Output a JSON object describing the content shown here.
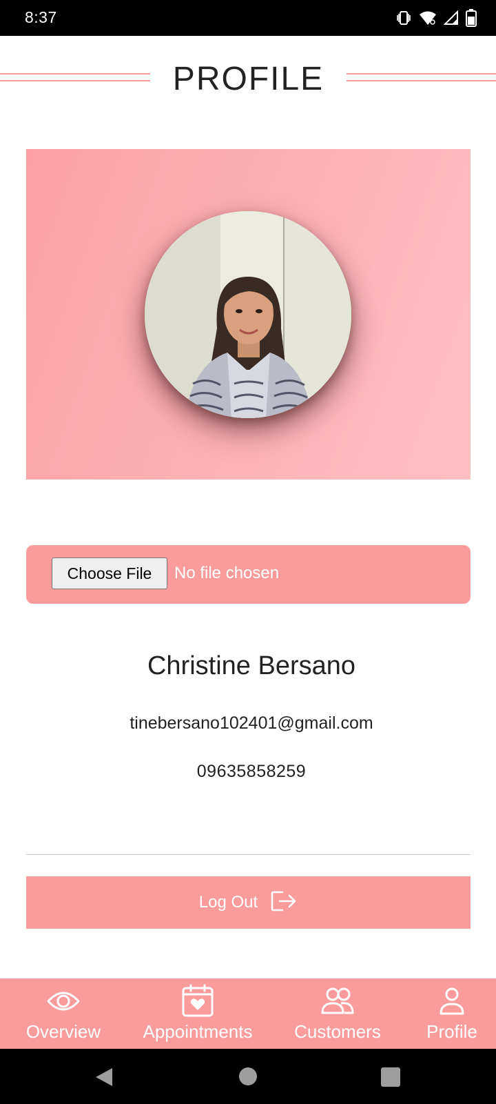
{
  "status_bar": {
    "time": "8:37",
    "icons": [
      "vibrate-icon",
      "wifi-icon",
      "signal-icon",
      "battery-icon"
    ]
  },
  "header": {
    "title": "PROFILE"
  },
  "profile": {
    "avatar_icon": "profile-photo",
    "file_input": {
      "button_label": "Choose File",
      "status": "No file chosen"
    },
    "name": "Christine Bersano",
    "email": "tinebersano102401@gmail.com",
    "phone": "09635858259"
  },
  "logout": {
    "label": "Log Out",
    "icon": "logout-icon"
  },
  "bottom_nav": {
    "items": [
      {
        "label": "Overview",
        "icon": "eye-icon"
      },
      {
        "label": "Appointments",
        "icon": "calendar-heart-icon"
      },
      {
        "label": "Customers",
        "icon": "users-icon"
      },
      {
        "label": "Profile",
        "icon": "user-icon"
      }
    ]
  },
  "colors": {
    "accent": "#fb9c9c",
    "hero_gradient_start": "#fca0a4",
    "hero_gradient_end": "#fdbfc2",
    "text": "#222222"
  }
}
